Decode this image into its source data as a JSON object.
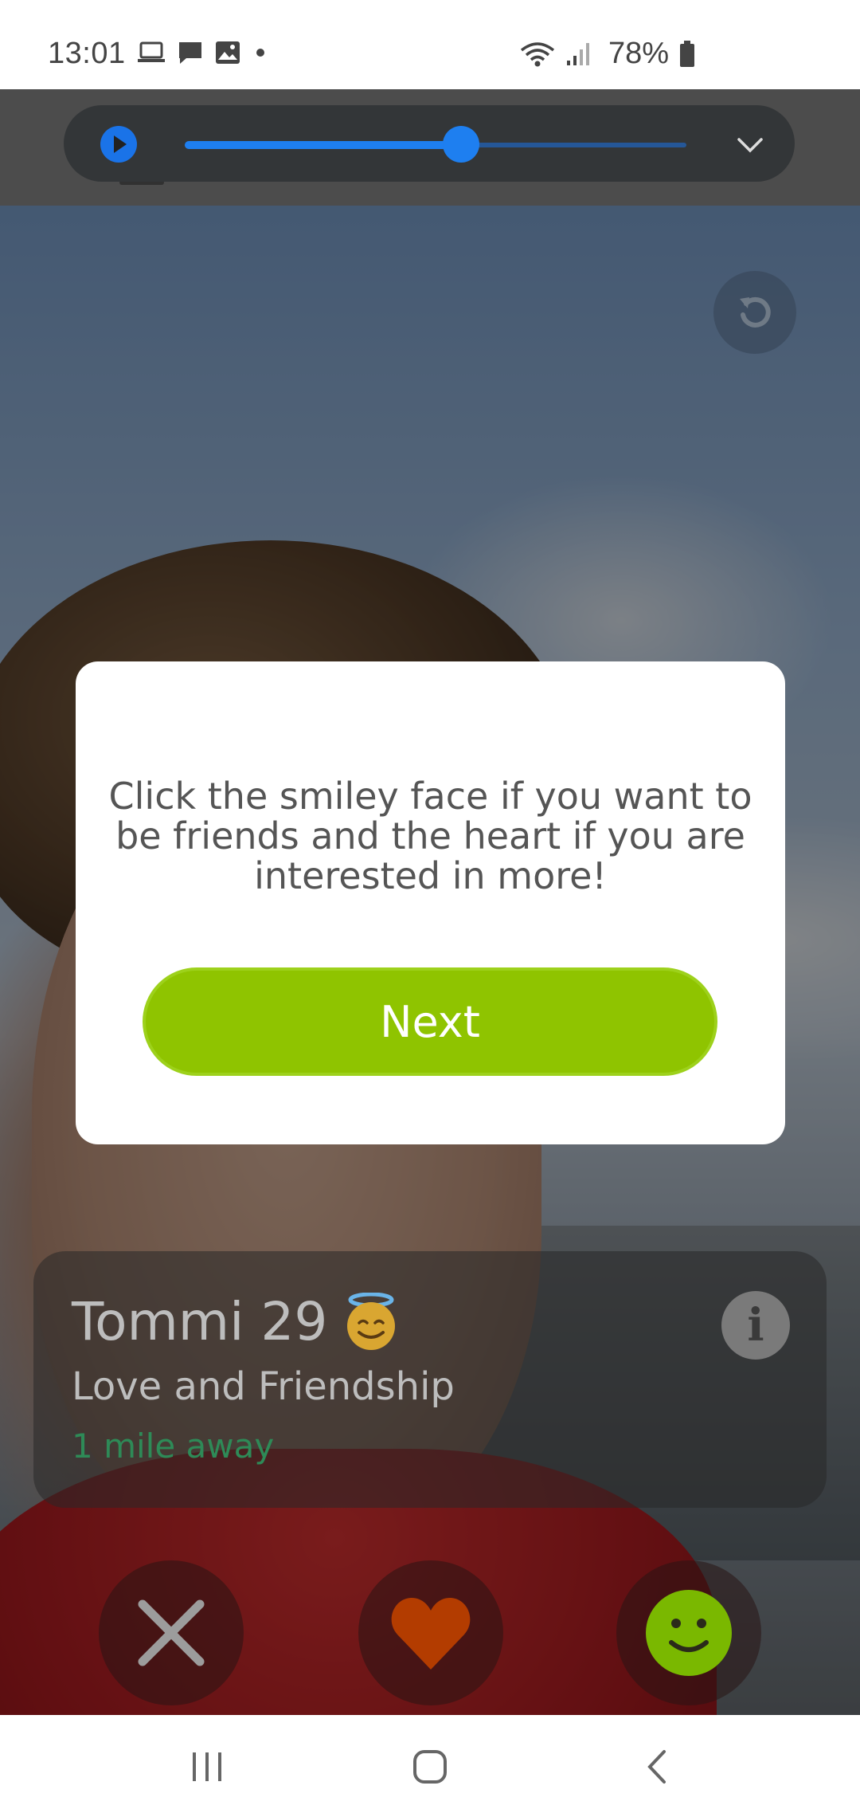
{
  "status_bar": {
    "time": "13:01",
    "battery_percent": "78%",
    "icons_left": [
      "laptop-icon",
      "message-icon",
      "image-icon",
      "dot-icon"
    ],
    "icons_right": [
      "wifi-icon",
      "signal-icon",
      "battery-icon"
    ]
  },
  "media_controller": {
    "playing": false,
    "seek_progress": 0.55,
    "accent_color": "#1a73e8"
  },
  "modal": {
    "message": "Click the smiley face if you want to be friends and the heart if you are interested in more!",
    "next_label": "Next",
    "button_color": "#8fc400"
  },
  "profile": {
    "name_age": "Tommi 29",
    "emoji": "smiling-face-with-halo",
    "subtitle": "Love and Friendship",
    "distance": "1 mile away",
    "distance_color": "#2e8a57"
  },
  "actions": {
    "pass_icon": "close-icon",
    "like_icon": "heart-icon",
    "friend_icon": "smiley-icon",
    "like_color": "#b33c00",
    "friend_color": "#7ab800"
  },
  "nav": {
    "buttons": [
      "recent-apps-icon",
      "home-icon",
      "back-icon"
    ]
  }
}
